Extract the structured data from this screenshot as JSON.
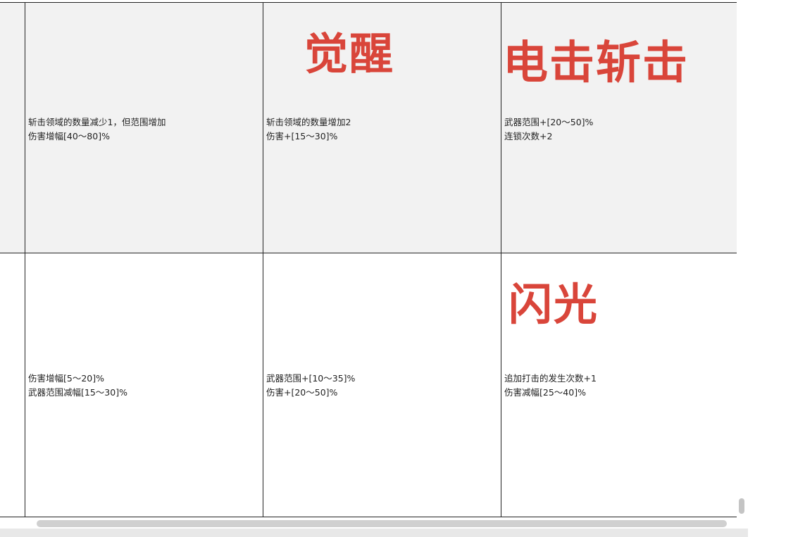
{
  "table": {
    "rows": [
      {
        "cells": [
          {
            "handwritten": "",
            "lines": []
          },
          {
            "handwritten": "",
            "lines": [
              "斩击领域的数量减少1，但范围增加",
              "伤害增幅[40～80]%"
            ]
          },
          {
            "handwritten": "觉醒",
            "lines": [
              "斩击领域的数量增加2",
              "伤害+[15～30]%"
            ]
          },
          {
            "handwritten": "电击斩击",
            "lines": [
              "武器范围+[20～50]%",
              "连锁次数+2"
            ]
          }
        ]
      },
      {
        "cells": [
          {
            "handwritten": "",
            "lines": []
          },
          {
            "handwritten": "",
            "lines": [
              "伤害增幅[5～20]%",
              "武器范围减幅[15～30]%"
            ]
          },
          {
            "handwritten": "",
            "lines": [
              "武器范围+[10～35]%",
              "伤害+[20～50]%"
            ]
          },
          {
            "handwritten": "闪光",
            "lines": [
              "追加打击的发生次数+1",
              "伤害减幅[25～40]%"
            ]
          }
        ]
      }
    ]
  },
  "colors": {
    "handwriting": "#d9453a",
    "row_shaded": "#f2f2f2",
    "grid_line": "#222222"
  }
}
